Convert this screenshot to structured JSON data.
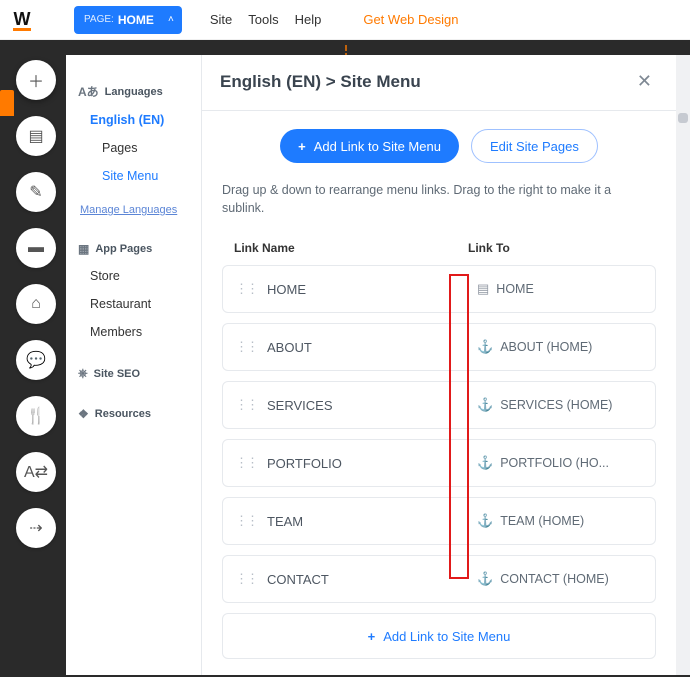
{
  "topbar": {
    "page_label": "PAGE:",
    "page_value": "HOME",
    "menu": [
      "Site",
      "Tools",
      "Help"
    ],
    "cta": "Get Web Design"
  },
  "rail_icons": [
    "plus",
    "layout",
    "design",
    "folder",
    "storefront",
    "chat",
    "utensils",
    "translate",
    "route"
  ],
  "sidebar": {
    "languages_heading": "Languages",
    "current_lang": "English (EN)",
    "pages_label": "Pages",
    "site_menu_label": "Site Menu",
    "manage_link": "Manage Languages",
    "app_pages_heading": "App Pages",
    "app_pages": [
      "Store",
      "Restaurant",
      "Members"
    ],
    "seo_heading": "Site SEO",
    "resources_heading": "Resources"
  },
  "panel": {
    "title": "English (EN) > Site Menu",
    "add_link_btn": "Add Link to Site Menu",
    "edit_pages_btn": "Edit Site Pages",
    "hint": "Drag up & down to rearrange menu links. Drag to the right to make it a sublink.",
    "col_name": "Link Name",
    "col_to": "Link To",
    "rows": [
      {
        "name": "HOME",
        "icon": "page",
        "to": "HOME"
      },
      {
        "name": "ABOUT",
        "icon": "anchor",
        "to": "ABOUT (HOME)"
      },
      {
        "name": "SERVICES",
        "icon": "anchor",
        "to": "SERVICES (HOME)"
      },
      {
        "name": "PORTFOLIO",
        "icon": "anchor",
        "to": "PORTFOLIO (HO..."
      },
      {
        "name": "TEAM",
        "icon": "anchor",
        "to": "TEAM (HOME)"
      },
      {
        "name": "CONTACT",
        "icon": "anchor",
        "to": "CONTACT (HOME)"
      }
    ],
    "add_row": "Add Link to Site Menu"
  }
}
